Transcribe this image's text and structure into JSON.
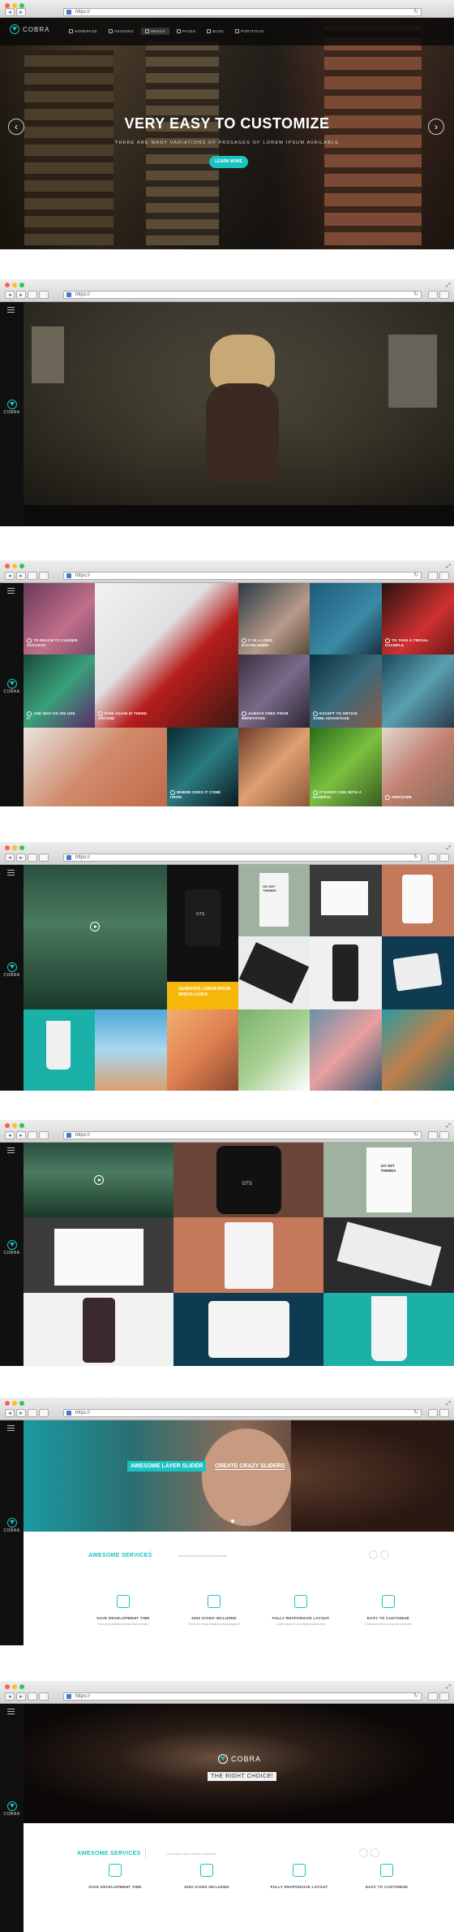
{
  "browser": {
    "url": "https://",
    "reload": "↻",
    "back": "◂",
    "forward": "▸"
  },
  "brand": {
    "name": "COBRA",
    "accent": "#19c3c1"
  },
  "screen1": {
    "nav": [
      {
        "label": "HOMEPAGE",
        "icon": "home-icon"
      },
      {
        "label": "HEADERS",
        "icon": "header-icon"
      },
      {
        "label": "MENUS",
        "icon": "menu-icon"
      },
      {
        "label": "PAGES",
        "icon": "page-icon"
      },
      {
        "label": "BLOG",
        "icon": "blog-icon"
      },
      {
        "label": "PORTFOLIO",
        "icon": "portfolio-icon"
      }
    ],
    "hero_title": "VERY EASY TO CUSTOMIZE",
    "hero_subtitle": "THERE ARE MANY VARIATIONS OF PASSAGES OF LOREM IPSUM AVAILABLE",
    "cta": "LEARN MORE",
    "prev": "‹",
    "next": "›"
  },
  "screen3": {
    "captions": [
      "TO REACH TO CAREER SUCCESS",
      "NOW AGAIN IS THERE ANYONE",
      "IT IS A LONG ESTABLISHED",
      "TO TAKE A TRIVIAL EXAMPLE",
      "AND WHY DO WE USE IT",
      "ALWAYS FREE FROM REPETITION",
      "EXCEPT TO OBTAIN SOME ADVANTAGE",
      "WHERE DOES IT COME FROM",
      "IT EVERY ONE WITH A HANDFUL",
      "AWESOME"
    ]
  },
  "screen4": {
    "yellow_tile": "GENERATE LOREM IPSUM WHICH LOOKS",
    "yellow_color": "#f5b70a"
  },
  "screen6": {
    "slider_tag": "AWESOME LAYER SLIDER",
    "slider_title": "CREATE CRAZY SLIDERS",
    "section_title": "AWESOME SERVICES",
    "section_desc": "Lorem ipsum dolor sit amet consectetur",
    "services": [
      {
        "name": "SAVE DEVELOPMENT TIME",
        "desc": "It is a long established fact that a reader",
        "icon": "clock-icon"
      },
      {
        "name": "4000 ICONS INCLUDED",
        "desc": "There are many variations of passages of",
        "icon": "image-icon"
      },
      {
        "name": "FULLY RESPONSIVE LAYOUT",
        "desc": "Lorem ipsum is not simply random text",
        "icon": "tablet-icon"
      },
      {
        "name": "EASY TO CUSTOMIZE",
        "desc": "It has survived not only five centuries",
        "icon": "brush-icon"
      }
    ]
  },
  "screen7": {
    "logo": "COBRA",
    "tagline": "THE RIGHT CHOICE!",
    "section_title": "AWESOME SERVICES",
    "section_desc": "Lorem ipsum dolor sit amet consectetur",
    "services": [
      {
        "name": "SAVE DEVELOPMENT TIME",
        "icon": "clock-icon"
      },
      {
        "name": "4000 ICONS INCLUDED",
        "icon": "image-icon"
      },
      {
        "name": "FULLY RESPONSIVE LAYOUT",
        "icon": "tablet-icon"
      },
      {
        "name": "EASY TO CUSTOMIZE",
        "icon": "brush-icon"
      }
    ]
  },
  "shirt_brand": "GTS",
  "book_text": "GO GET THEMES"
}
